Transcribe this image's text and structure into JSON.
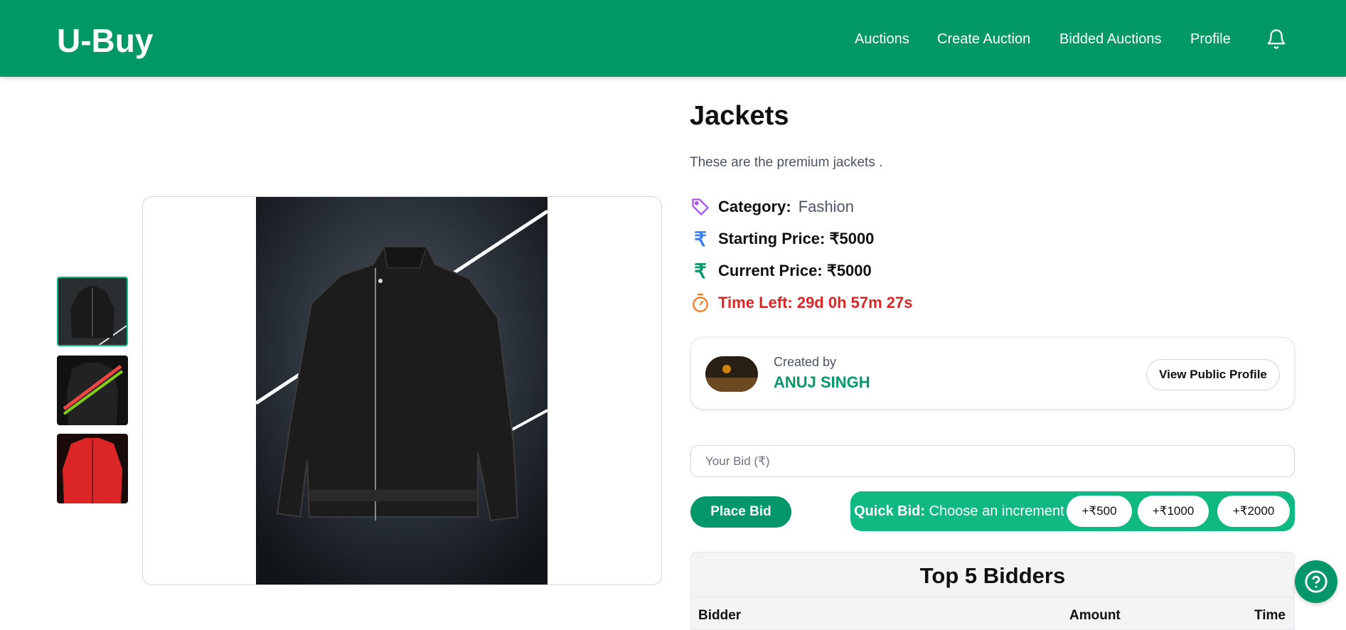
{
  "brand": {
    "logo": "U-Buy"
  },
  "nav": {
    "links": [
      "Auctions",
      "Create Auction",
      "Bidded Auctions",
      "Profile"
    ],
    "bell_icon": "bell-icon"
  },
  "gallery": {
    "thumbnails": [
      {
        "name": "black-leather-jacket-thumb",
        "active": true
      },
      {
        "name": "black-striped-jacket-thumb",
        "active": false
      },
      {
        "name": "red-jacket-thumb",
        "active": false
      }
    ],
    "main_image": "black-leather-jacket"
  },
  "auction": {
    "title": "Jackets",
    "description": "These are the premium jackets .",
    "category_label": "Category:",
    "category_value": "Fashion",
    "starting_price": "Starting Price: ₹5000",
    "current_price": "Current Price: ₹5000",
    "time_left": "Time Left: 29d 0h 57m 27s"
  },
  "creator": {
    "created_by_label": "Created by",
    "name": "ANUJ SINGH",
    "view_profile_label": "View Public Profile"
  },
  "bid": {
    "placeholder": "Your Bid (₹)",
    "place_bid_label": "Place Bid",
    "quick_bid_title": "Quick Bid:",
    "quick_bid_text": "Choose an increment",
    "increments": [
      "+₹500",
      "+₹1000",
      "+₹2000"
    ]
  },
  "bidders": {
    "title": "Top 5 Bidders",
    "columns": [
      "Bidder",
      "Amount",
      "Time"
    ]
  },
  "colors": {
    "primary": "#009966",
    "accent": "#10b981",
    "danger": "#dc2626",
    "category_icon": "#a855f7",
    "starting_icon": "#3b82f6",
    "current_icon": "#059669",
    "timer_icon": "#f97316"
  }
}
